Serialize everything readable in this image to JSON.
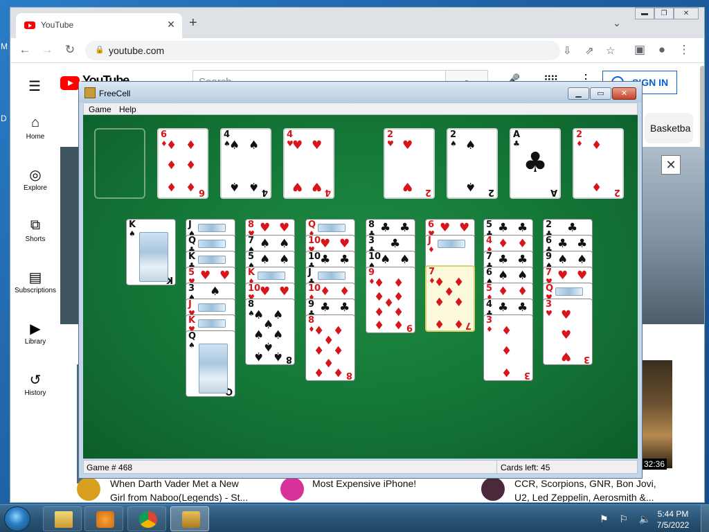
{
  "desktop": {
    "frag_1": "M",
    "frag_2": "D"
  },
  "browser": {
    "tab_title": "YouTube",
    "tab_close": "✕",
    "new_tab": "+",
    "url": "youtube.com",
    "window_controls": [
      "▬",
      "❐",
      "✕"
    ]
  },
  "youtube": {
    "logo_text": "YouTube",
    "search_placeholder": "Search",
    "sign_in": "SIGN IN",
    "sidebar": [
      {
        "label": "Home",
        "icon": "home-icon"
      },
      {
        "label": "Explore",
        "icon": "explore-icon"
      },
      {
        "label": "Shorts",
        "icon": "shorts-icon"
      },
      {
        "label": "Subscriptions",
        "icon": "subscriptions-icon"
      },
      {
        "label": "Library",
        "icon": "library-icon"
      },
      {
        "label": "History",
        "icon": "history-icon"
      }
    ],
    "chip": "Basketba",
    "duration": "32:36",
    "videos": [
      {
        "title_line1": "When Darth Vader Met a New",
        "title_line2": "Girl from Naboo(Legends) - St..."
      },
      {
        "title_line1": "Most Expensive iPhone!"
      },
      {
        "title_line1": "CCR, Scorpions, GNR, Bon Jovi,",
        "title_line2": "U2, Led Zeppelin, Aerosmith &..."
      }
    ],
    "ad_close": "✕"
  },
  "freecell": {
    "title": "FreeCell",
    "menu": [
      "Game",
      "Help"
    ],
    "game_label": "Game # 468",
    "cards_left_label": "Cards left: 45",
    "free_cells": [
      null,
      {
        "rank": "6",
        "suit": "♦",
        "color": "red"
      },
      {
        "rank": "4",
        "suit": "♠",
        "color": "blk"
      },
      {
        "rank": "4",
        "suit": "♥",
        "color": "red"
      }
    ],
    "foundations": [
      {
        "rank": "2",
        "suit": "♥",
        "color": "red"
      },
      {
        "rank": "2",
        "suit": "♠",
        "color": "blk"
      },
      {
        "rank": "A",
        "suit": "♣",
        "color": "blk"
      },
      {
        "rank": "2",
        "suit": "♦",
        "color": "red"
      }
    ],
    "columns": [
      [
        {
          "rank": "K",
          "suit": "♠",
          "color": "blk"
        }
      ],
      [
        {
          "rank": "J",
          "suit": "♠",
          "color": "blk"
        },
        {
          "rank": "Q",
          "suit": "♣",
          "color": "blk"
        },
        {
          "rank": "K",
          "suit": "♣",
          "color": "blk"
        },
        {
          "rank": "5",
          "suit": "♥",
          "color": "red"
        },
        {
          "rank": "3",
          "suit": "♠",
          "color": "blk"
        },
        {
          "rank": "J",
          "suit": "♥",
          "color": "red"
        },
        {
          "rank": "K",
          "suit": "♥",
          "color": "red"
        },
        {
          "rank": "Q",
          "suit": "♠",
          "color": "blk"
        }
      ],
      [
        {
          "rank": "8",
          "suit": "♥",
          "color": "red"
        },
        {
          "rank": "7",
          "suit": "♠",
          "color": "blk"
        },
        {
          "rank": "5",
          "suit": "♠",
          "color": "blk"
        },
        {
          "rank": "K",
          "suit": "♦",
          "color": "red"
        },
        {
          "rank": "10",
          "suit": "♥",
          "color": "red"
        },
        {
          "rank": "8",
          "suit": "♠",
          "color": "blk"
        }
      ],
      [
        {
          "rank": "Q",
          "suit": "♦",
          "color": "red"
        },
        {
          "rank": "10",
          "suit": "♥",
          "color": "red"
        },
        {
          "rank": "10",
          "suit": "♣",
          "color": "blk"
        },
        {
          "rank": "J",
          "suit": "♣",
          "color": "blk"
        },
        {
          "rank": "10",
          "suit": "♦",
          "color": "red"
        },
        {
          "rank": "9",
          "suit": "♣",
          "color": "blk"
        },
        {
          "rank": "8",
          "suit": "♦",
          "color": "red"
        }
      ],
      [
        {
          "rank": "8",
          "suit": "♣",
          "color": "blk"
        },
        {
          "rank": "3",
          "suit": "♣",
          "color": "blk"
        },
        {
          "rank": "10",
          "suit": "♠",
          "color": "blk"
        },
        {
          "rank": "9",
          "suit": "♦",
          "color": "red"
        }
      ],
      [
        {
          "rank": "6",
          "suit": "♥",
          "color": "red"
        },
        {
          "rank": "J",
          "suit": "♦",
          "color": "red"
        },
        {
          "rank": "7",
          "suit": "♦",
          "color": "red"
        }
      ],
      [
        {
          "rank": "5",
          "suit": "♣",
          "color": "blk"
        },
        {
          "rank": "4",
          "suit": "♦",
          "color": "red"
        },
        {
          "rank": "7",
          "suit": "♣",
          "color": "blk"
        },
        {
          "rank": "6",
          "suit": "♠",
          "color": "blk"
        },
        {
          "rank": "5",
          "suit": "♦",
          "color": "red"
        },
        {
          "rank": "4",
          "suit": "♣",
          "color": "blk"
        },
        {
          "rank": "3",
          "suit": "♦",
          "color": "red"
        }
      ],
      [
        {
          "rank": "2",
          "suit": "♣",
          "color": "blk"
        },
        {
          "rank": "6",
          "suit": "♣",
          "color": "blk"
        },
        {
          "rank": "9",
          "suit": "♠",
          "color": "blk"
        },
        {
          "rank": "7",
          "suit": "♥",
          "color": "red"
        },
        {
          "rank": "Q",
          "suit": "♥",
          "color": "red"
        },
        {
          "rank": "3",
          "suit": "♥",
          "color": "red"
        }
      ]
    ]
  },
  "taskbar": {
    "time": "5:44 PM",
    "date": "7/5/2022",
    "tray": "⚑ ⚐ 🔈"
  }
}
